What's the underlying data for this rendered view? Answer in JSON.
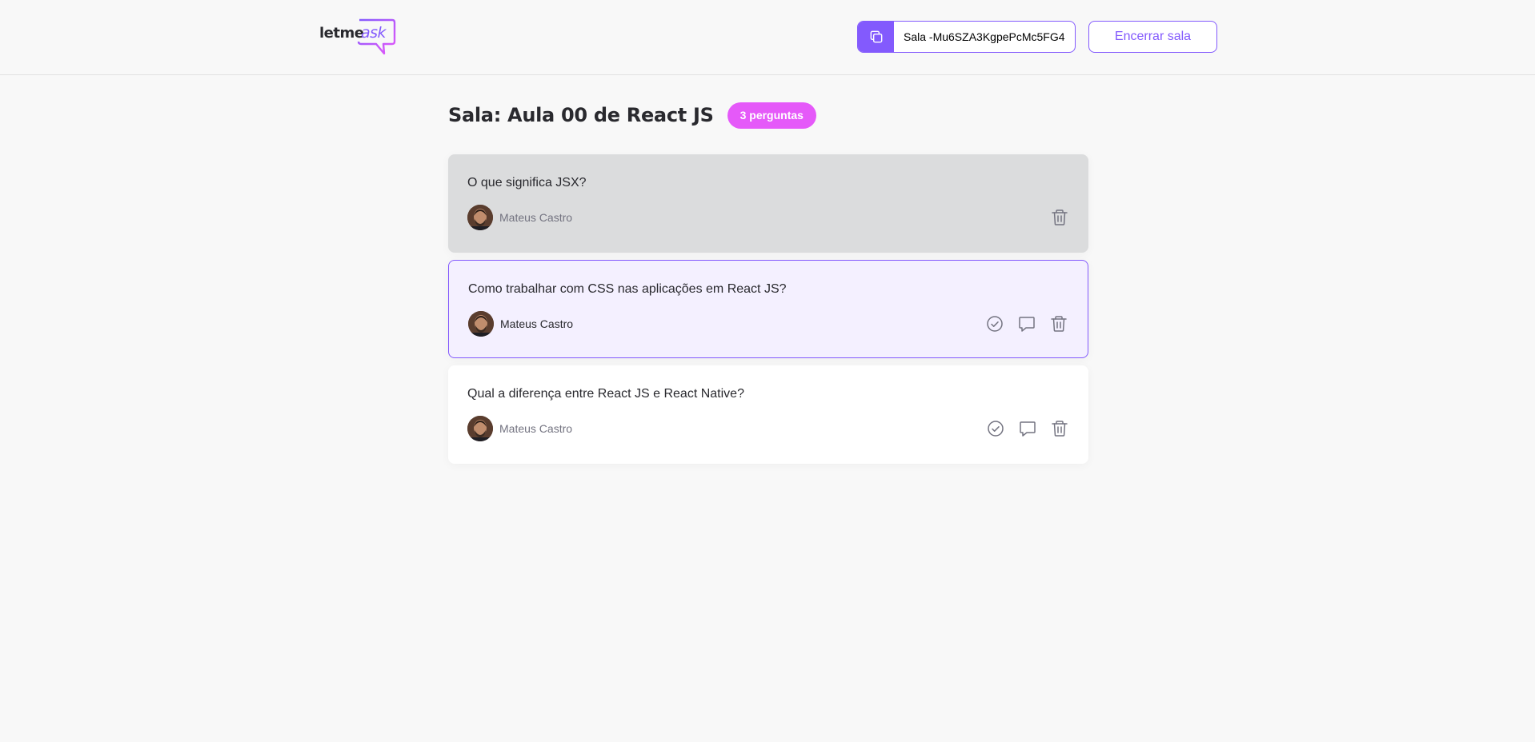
{
  "header": {
    "logo": {
      "text_1": "letme",
      "text_2": "ask"
    },
    "room_code": {
      "label": "Sala -Mu6SZA3KgpePcMc5FG4",
      "icon": "copy-icon"
    },
    "close_room_label": "Encerrar sala"
  },
  "room": {
    "title": "Sala: Aula 00 de React JS",
    "question_count_label": "3 perguntas"
  },
  "questions": [
    {
      "content": "O que significa JSX?",
      "author": "Mateus Castro",
      "state": "answered",
      "actions": [
        "trash-icon"
      ]
    },
    {
      "content": "Como trabalhar com CSS nas aplicações em React JS?",
      "author": "Mateus Castro",
      "state": "highlighted",
      "actions": [
        "check-circle-icon",
        "answer-icon",
        "trash-icon"
      ]
    },
    {
      "content": "Qual a diferença entre React JS e React Native?",
      "author": "Mateus Castro",
      "state": "default",
      "actions": [
        "check-circle-icon",
        "answer-icon",
        "trash-icon"
      ]
    }
  ],
  "colors": {
    "accent": "#835afd",
    "badge": "#e559f9",
    "background": "#f8f8f8",
    "answered_bg": "#dbdcdd",
    "highlighted_bg": "#f4f0ff"
  }
}
